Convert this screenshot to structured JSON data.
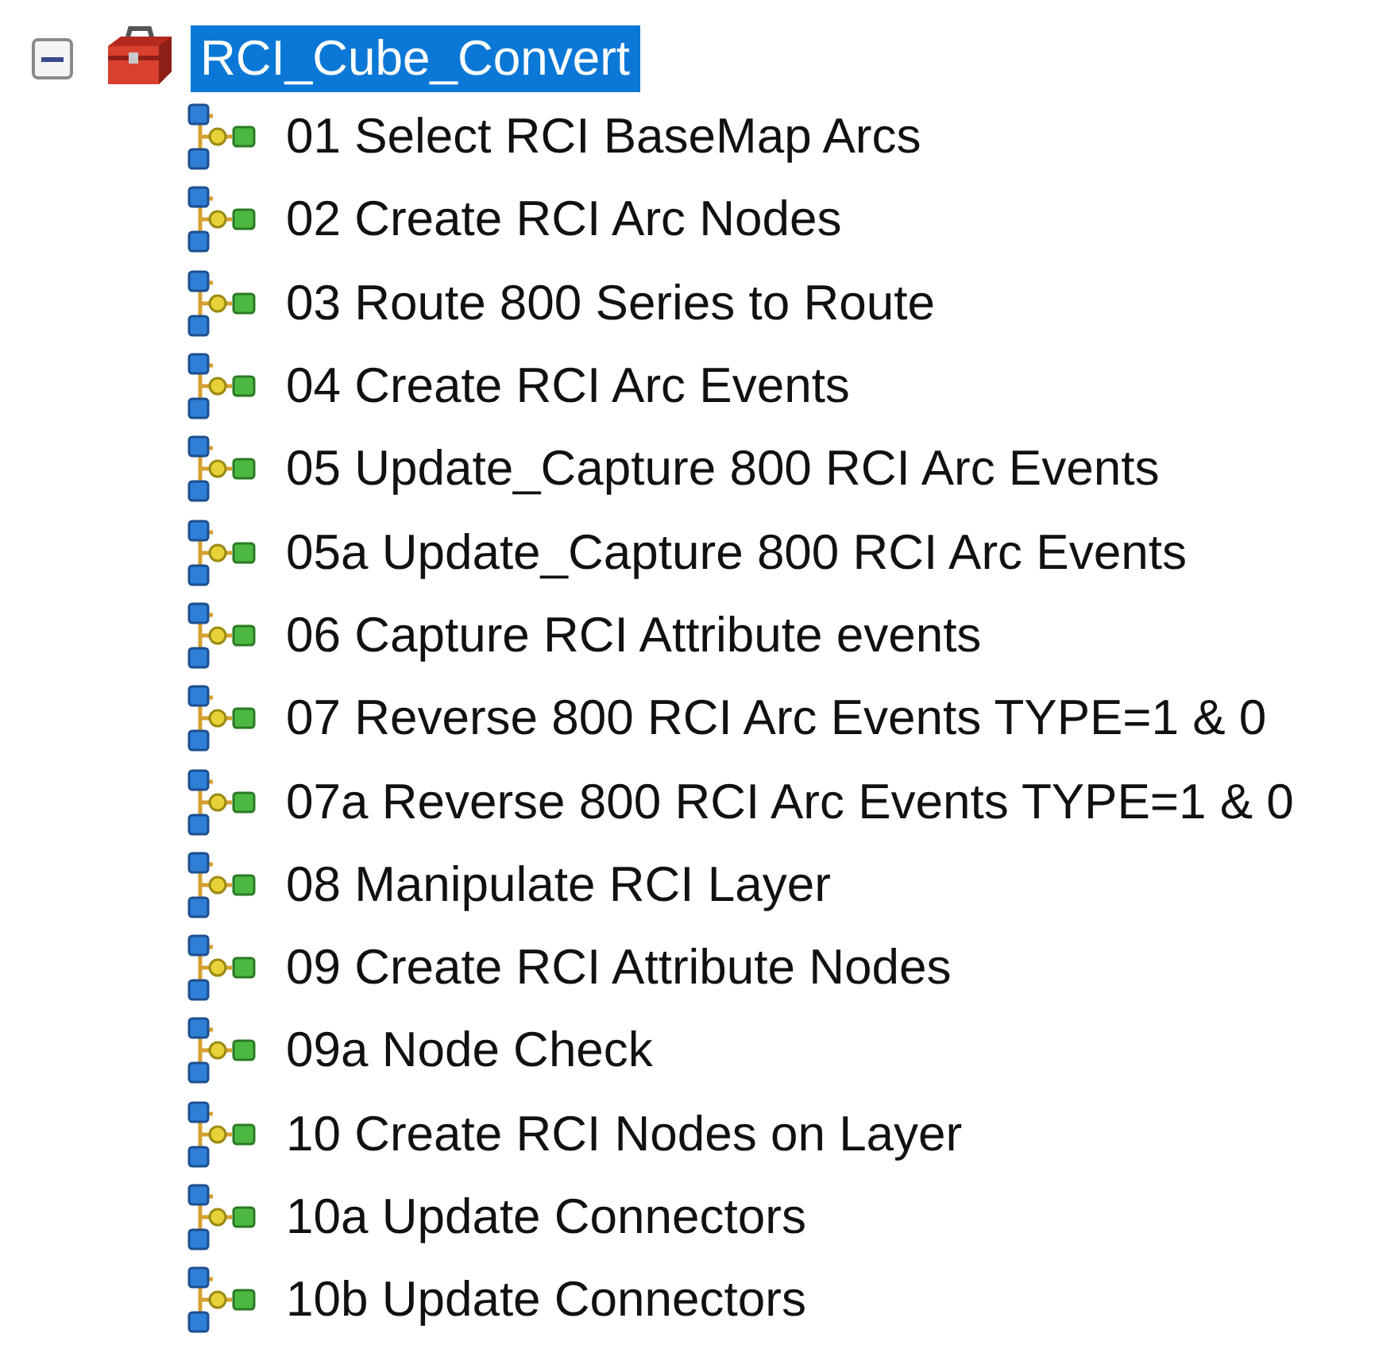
{
  "tree": {
    "label": "RCI_Cube_Convert",
    "expanded": true,
    "selected": true,
    "children": [
      {
        "label": "01 Select RCI BaseMap Arcs",
        "selected": false
      },
      {
        "label": "02 Create RCI Arc Nodes",
        "selected": false
      },
      {
        "label": "03 Route 800 Series to Route",
        "selected": false
      },
      {
        "label": "04 Create RCI Arc Events",
        "selected": false
      },
      {
        "label": "05 Update_Capture 800 RCI Arc Events",
        "selected": false
      },
      {
        "label": "05a Update_Capture 800 RCI Arc Events",
        "selected": false
      },
      {
        "label": "06 Capture RCI Attribute events",
        "selected": false
      },
      {
        "label": "07 Reverse 800 RCI Arc Events TYPE=1 & 0",
        "selected": false
      },
      {
        "label": "07a Reverse 800 RCI Arc Events TYPE=1 & 0",
        "selected": false
      },
      {
        "label": "08 Manipulate RCI Layer",
        "selected": false
      },
      {
        "label": "09 Create RCI Attribute Nodes",
        "selected": false
      },
      {
        "label": "09a Node Check",
        "selected": false
      },
      {
        "label": "10 Create RCI Nodes on Layer",
        "selected": false
      },
      {
        "label": "10a Update Connectors",
        "selected": false
      },
      {
        "label": "10b Update Connectors",
        "selected": false
      }
    ]
  }
}
